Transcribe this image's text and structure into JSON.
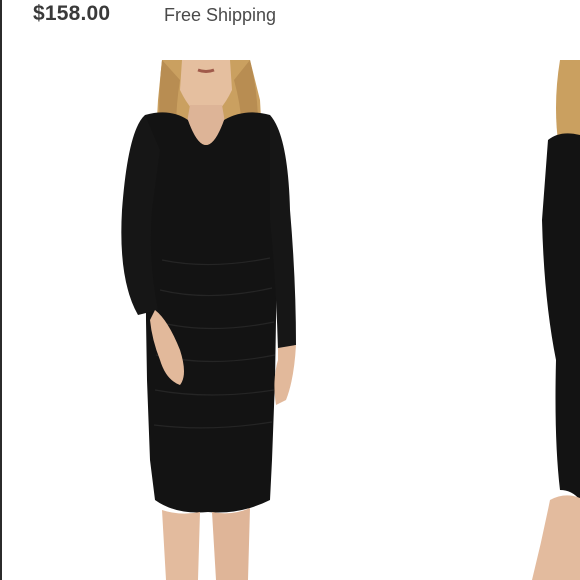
{
  "listing": {
    "price": "$158.00",
    "shipping": "Free Shipping"
  },
  "gallery": {
    "main_image_alt": "Model wearing black long-sleeve ruched midi dress",
    "next_image_alt": "Side view of black long-sleeve midi dress"
  },
  "colors": {
    "dress": "#131313",
    "skin": "#e7c2a8",
    "hair": "#caa060",
    "text": "#3a3a3a"
  }
}
